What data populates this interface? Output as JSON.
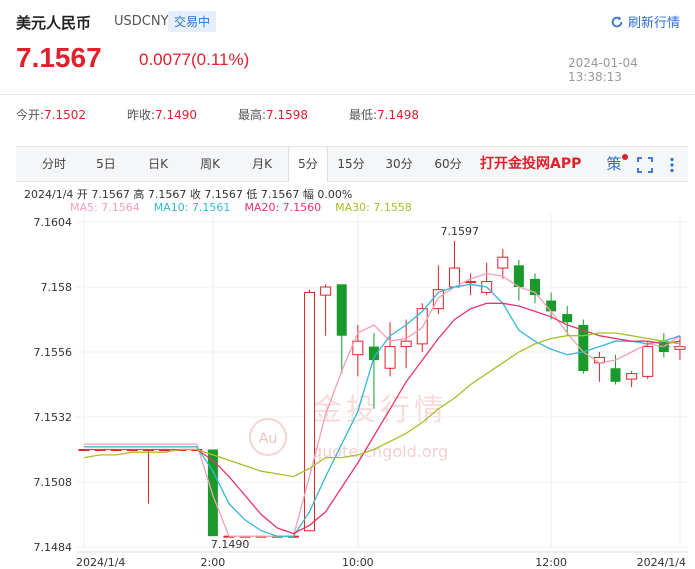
{
  "header": {
    "title": "美元人民币",
    "code": "USDCNY",
    "status": "交易中",
    "refresh_label": "刷新行情",
    "price": "7.1567",
    "change": "0.0077(0.11%)",
    "timestamp": "2024-01-04 13:38:13"
  },
  "quote": [
    {
      "label": "今开:",
      "value": "7.1502"
    },
    {
      "label": "昨收:",
      "value": "7.1490"
    },
    {
      "label": "最高:",
      "value": "7.1598"
    },
    {
      "label": "最低:",
      "value": "7.1498"
    }
  ],
  "tabs": [
    "分时",
    "5日",
    "日K",
    "周K",
    "月K",
    "5分",
    "15分",
    "30分",
    "60分"
  ],
  "active_tab": "5分",
  "app_promo": "打开金投网APP",
  "toolbar": {
    "policy_label": "策",
    "fullscreen_icon": "fullscreen-icon",
    "more_icon": "more-vert-icon"
  },
  "colors": {
    "up": "#e0202b",
    "down": "#1a9a2a",
    "accent": "#2f6fd0",
    "ma5": "#f4a0b4",
    "ma10": "#35b8d4",
    "ma20": "#e8356a",
    "ma30": "#a3c02a"
  },
  "watermark": {
    "brand": "金投行情",
    "domain": "quote.cngold.org",
    "logo_letters": "Au"
  },
  "chart_data": {
    "type": "candlestick",
    "info": {
      "date": "2024/1/4",
      "open_label": "开",
      "open": "7.1567",
      "high_label": "高",
      "high": "7.1567",
      "close_label": "收",
      "close": "7.1567",
      "low_label": "低",
      "low": "7.1567",
      "amp_label": "幅",
      "amplitude": "0.00%"
    },
    "ma_legend": [
      {
        "name": "MA5",
        "value": "7.1564",
        "color": "#f4a0b4"
      },
      {
        "name": "MA10",
        "value": "7.1561",
        "color": "#35b8d4"
      },
      {
        "name": "MA20",
        "value": "7.1560",
        "color": "#e8356a"
      },
      {
        "name": "MA30",
        "value": "7.1558",
        "color": "#a3c02a"
      }
    ],
    "y_ticks": [
      7.1604,
      7.158,
      7.1556,
      7.1532,
      7.1508,
      7.1484
    ],
    "y_tick_labels": [
      "7.1604",
      "7.158",
      "7.1556",
      "7.1532",
      "7.1508",
      "7.1484"
    ],
    "ylim": [
      7.1484,
      7.1604
    ],
    "x_tick_labels": [
      "2024/1/4",
      "2:00",
      "10:00",
      "12:00",
      "2024/1/4"
    ],
    "x_tick_index": [
      0,
      8,
      17,
      29,
      37
    ],
    "max_label": "7.1597",
    "min_label": "7.1490",
    "candles": [
      {
        "o": 7.152,
        "h": 7.152,
        "l": 7.152,
        "c": 7.152
      },
      {
        "o": 7.152,
        "h": 7.152,
        "l": 7.152,
        "c": 7.152
      },
      {
        "o": 7.152,
        "h": 7.152,
        "l": 7.152,
        "c": 7.152
      },
      {
        "o": 7.152,
        "h": 7.152,
        "l": 7.152,
        "c": 7.152
      },
      {
        "o": 7.152,
        "h": 7.152,
        "l": 7.15,
        "c": 7.152
      },
      {
        "o": 7.152,
        "h": 7.152,
        "l": 7.152,
        "c": 7.152
      },
      {
        "o": 7.152,
        "h": 7.152,
        "l": 7.152,
        "c": 7.152
      },
      {
        "o": 7.152,
        "h": 7.152,
        "l": 7.152,
        "c": 7.152
      },
      {
        "o": 7.152,
        "h": 7.152,
        "l": 7.1488,
        "c": 7.1488
      },
      {
        "o": 7.1488,
        "h": 7.1488,
        "l": 7.1488,
        "c": 7.1488
      },
      {
        "o": 7.1488,
        "h": 7.1488,
        "l": 7.1488,
        "c": 7.1488
      },
      {
        "o": 7.1488,
        "h": 7.1488,
        "l": 7.1488,
        "c": 7.1488
      },
      {
        "o": 7.1488,
        "h": 7.1488,
        "l": 7.1488,
        "c": 7.1488
      },
      {
        "o": 7.1488,
        "h": 7.1488,
        "l": 7.1488,
        "c": 7.1488
      },
      {
        "o": 7.149,
        "h": 7.1579,
        "l": 7.149,
        "c": 7.1578
      },
      {
        "o": 7.1577,
        "h": 7.1581,
        "l": 7.1562,
        "c": 7.158
      },
      {
        "o": 7.1581,
        "h": 7.1581,
        "l": 7.1548,
        "c": 7.1562
      },
      {
        "o": 7.1555,
        "h": 7.1566,
        "l": 7.1547,
        "c": 7.156
      },
      {
        "o": 7.1558,
        "h": 7.1563,
        "l": 7.1535,
        "c": 7.1553
      },
      {
        "o": 7.155,
        "h": 7.1567,
        "l": 7.1547,
        "c": 7.1558
      },
      {
        "o": 7.1558,
        "h": 7.1568,
        "l": 7.155,
        "c": 7.156
      },
      {
        "o": 7.1559,
        "h": 7.1574,
        "l": 7.1556,
        "c": 7.1572
      },
      {
        "o": 7.1572,
        "h": 7.1588,
        "l": 7.157,
        "c": 7.1579
      },
      {
        "o": 7.158,
        "h": 7.1597,
        "l": 7.158,
        "c": 7.1587
      },
      {
        "o": 7.1582,
        "h": 7.1585,
        "l": 7.1577,
        "c": 7.1582
      },
      {
        "o": 7.1578,
        "h": 7.1589,
        "l": 7.1577,
        "c": 7.1582
      },
      {
        "o": 7.1587,
        "h": 7.1594,
        "l": 7.1583,
        "c": 7.1591
      },
      {
        "o": 7.1588,
        "h": 7.159,
        "l": 7.1575,
        "c": 7.158
      },
      {
        "o": 7.1583,
        "h": 7.1585,
        "l": 7.1574,
        "c": 7.1577
      },
      {
        "o": 7.1575,
        "h": 7.1578,
        "l": 7.1568,
        "c": 7.1571
      },
      {
        "o": 7.157,
        "h": 7.1573,
        "l": 7.1562,
        "c": 7.1567
      },
      {
        "o": 7.1566,
        "h": 7.1568,
        "l": 7.1548,
        "c": 7.1549
      },
      {
        "o": 7.1552,
        "h": 7.1556,
        "l": 7.1545,
        "c": 7.1554
      },
      {
        "o": 7.155,
        "h": 7.1555,
        "l": 7.1544,
        "c": 7.1545
      },
      {
        "o": 7.1546,
        "h": 7.1549,
        "l": 7.1543,
        "c": 7.1548
      },
      {
        "o": 7.1547,
        "h": 7.156,
        "l": 7.1546,
        "c": 7.1558
      },
      {
        "o": 7.156,
        "h": 7.1563,
        "l": 7.1554,
        "c": 7.1556
      },
      {
        "o": 7.1557,
        "h": 7.1562,
        "l": 7.1553,
        "c": 7.1558
      }
    ],
    "ma5": [
      7.1522,
      7.1522,
      7.1522,
      7.1522,
      7.1522,
      7.1522,
      7.1522,
      7.1522,
      7.1503,
      7.1488,
      7.1488,
      7.1488,
      7.1488,
      7.1488,
      7.151,
      7.1533,
      7.1549,
      7.1563,
      7.1566,
      7.156,
      7.1561,
      7.1565,
      7.1576,
      7.158,
      7.1583,
      7.1585,
      7.1584,
      7.158,
      7.1578,
      7.1571,
      7.1563,
      7.1556,
      7.1552,
      7.1553,
      7.1556,
      7.1559,
      7.1558,
      7.1562
    ],
    "ma10": [
      7.1521,
      7.1521,
      7.1521,
      7.1521,
      7.1521,
      7.1521,
      7.1521,
      7.1521,
      7.1512,
      7.15,
      7.1494,
      7.149,
      7.1488,
      7.1488,
      7.1497,
      7.151,
      7.1522,
      7.1534,
      7.1554,
      7.1562,
      7.1566,
      7.1571,
      7.1578,
      7.158,
      7.1581,
      7.158,
      7.1574,
      7.1564,
      7.156,
      7.1557,
      7.1555,
      7.1556,
      7.1558,
      7.156,
      7.156,
      7.1559,
      7.156,
      7.1562
    ],
    "ma20": [
      7.152,
      7.152,
      7.152,
      7.152,
      7.152,
      7.152,
      7.152,
      7.152,
      7.1516,
      7.151,
      7.1503,
      7.1496,
      7.1491,
      7.1489,
      7.1492,
      7.1497,
      7.1506,
      7.1515,
      7.1525,
      7.1535,
      7.1545,
      7.1553,
      7.1561,
      7.1568,
      7.1572,
      7.1574,
      7.1574,
      7.1573,
      7.1571,
      7.1569,
      7.1566,
      7.1564,
      7.1562,
      7.1561,
      7.156,
      7.156,
      7.1559,
      7.156
    ],
    "ma30": [
      7.1517,
      7.1518,
      7.1518,
      7.1519,
      7.1519,
      7.1519,
      7.152,
      7.152,
      7.1518,
      7.1516,
      7.1514,
      7.1512,
      7.1511,
      7.151,
      7.1513,
      7.1517,
      7.1517,
      7.1518,
      7.152,
      7.1523,
      7.1526,
      7.153,
      7.1535,
      7.1539,
      7.1544,
      7.1548,
      7.1552,
      7.1556,
      7.1559,
      7.1561,
      7.1562,
      7.1562,
      7.1563,
      7.1563,
      7.1562,
      7.1561,
      7.156,
      7.1559
    ]
  }
}
